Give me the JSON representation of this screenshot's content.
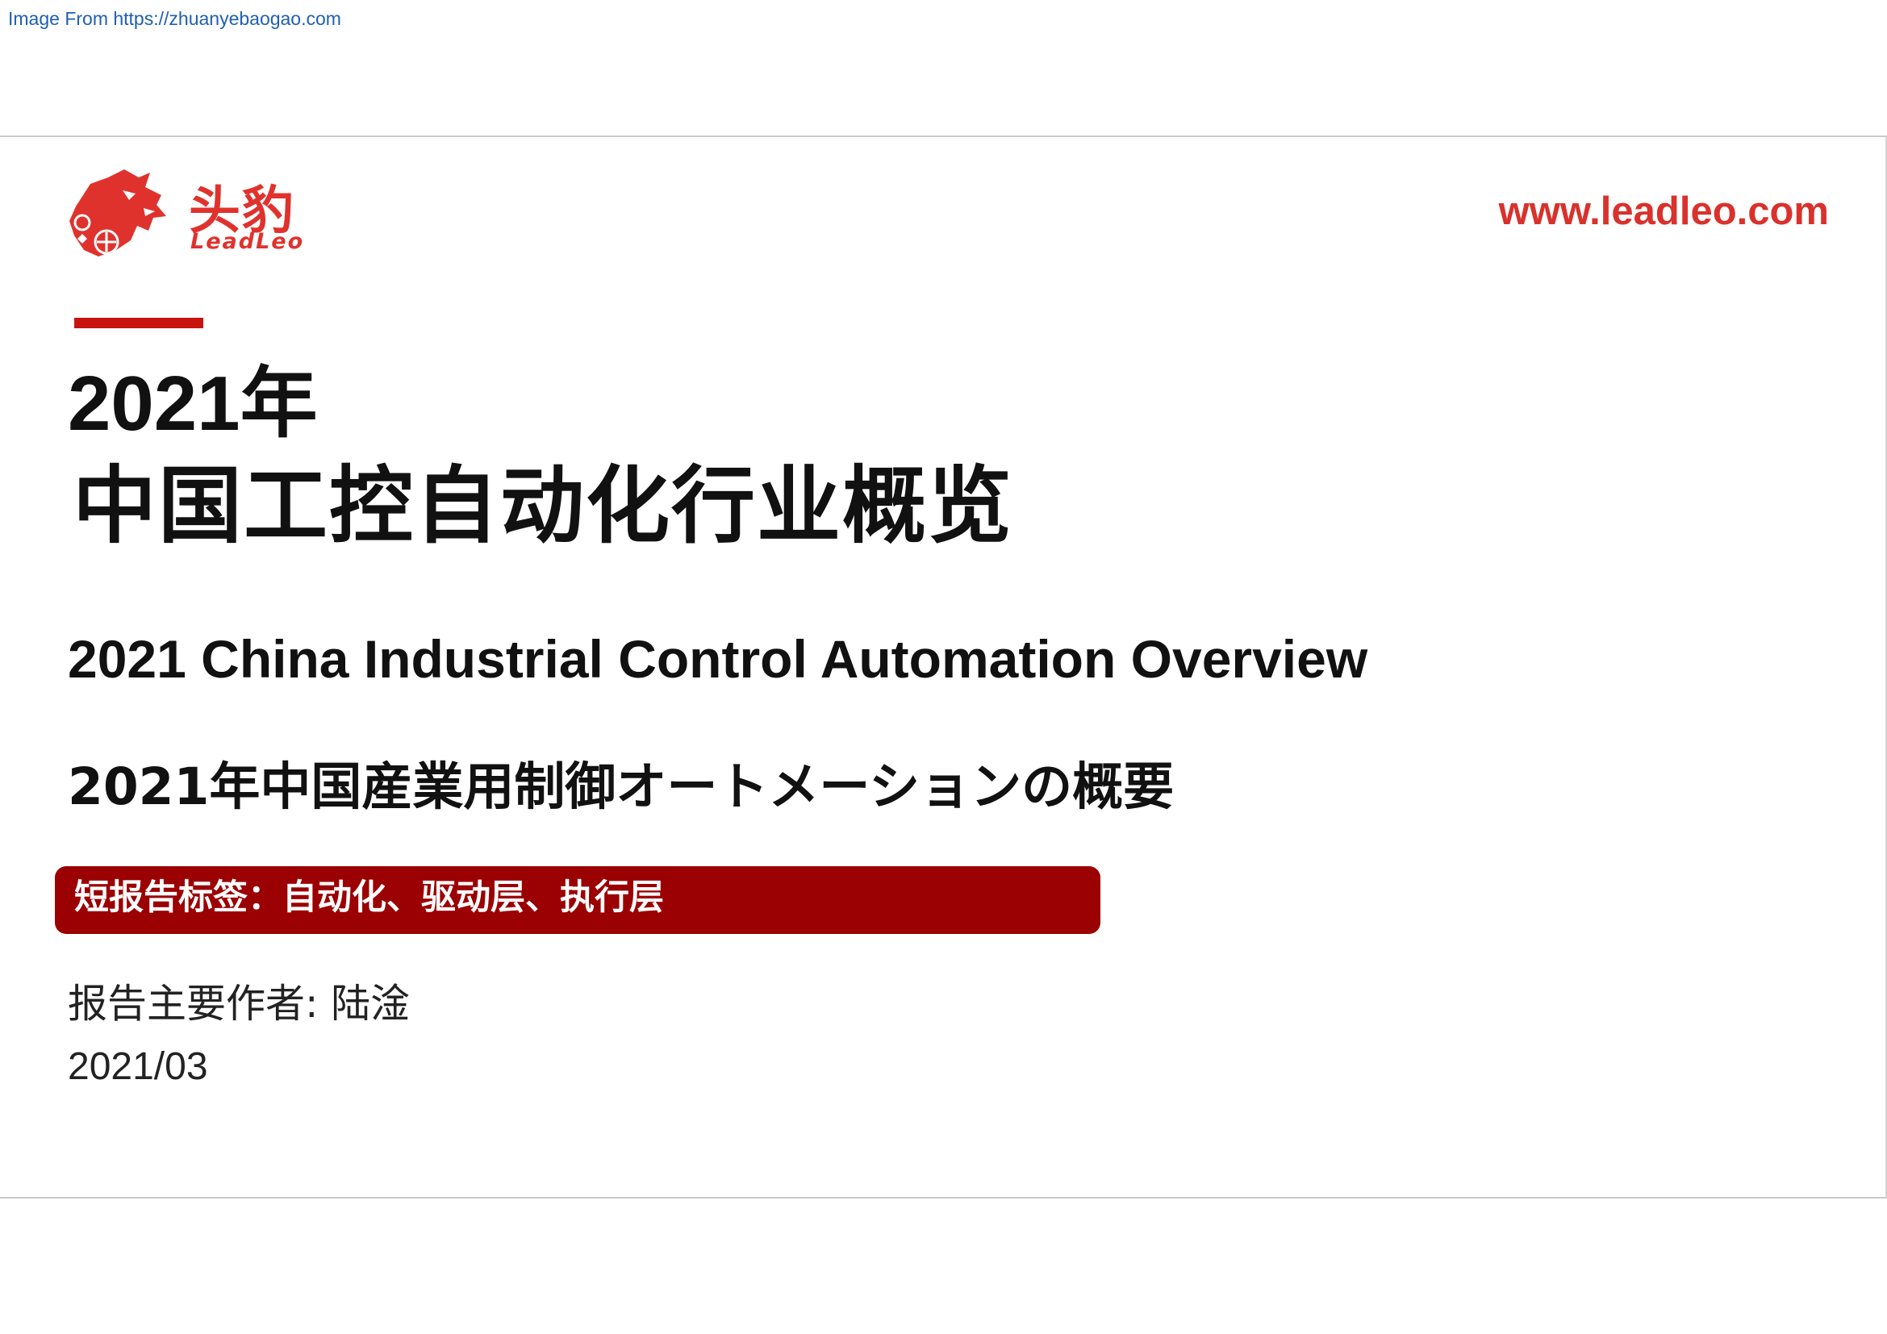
{
  "source_note": "Image From https://zhuanyebaogao.com",
  "brand": {
    "name_cn": "头豹",
    "name_en": "LeadLeo",
    "website": "www.leadleo.com",
    "color": "#e0322d"
  },
  "title": {
    "year": "2021年",
    "main_cn": "中国工控自动化行业概览",
    "english": "2021 China Industrial Control Automation Overview",
    "japanese": "2021年中国産業用制御オートメーションの概要"
  },
  "tags": {
    "text": "短报告标签：自动化、驱动层、执行层",
    "background_color": "#9b0003"
  },
  "author_line": "报告主要作者:  陆淦",
  "date": "2021/03",
  "icons": {
    "logo": "leopard-head-icon"
  }
}
